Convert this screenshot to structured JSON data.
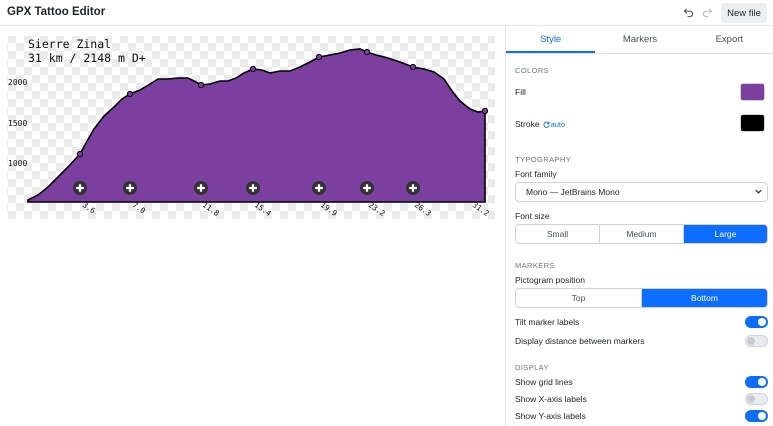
{
  "header": {
    "title": "GPX Tattoo Editor",
    "undo_icon": "undo-icon",
    "redo_icon": "redo-icon",
    "new_file_label": "New file"
  },
  "chart": {
    "title_line1": "Sierre Zinal",
    "title_line2": "31 km / 2148 m D+",
    "fill_color": "#7b3fa0",
    "stroke_color": "#000000",
    "y_ticks": [
      "2000",
      "1500",
      "1000"
    ],
    "x_ticks": [
      "3.6",
      "7.0",
      "11.8",
      "15.4",
      "19.9",
      "23.2",
      "26.3",
      "31.2"
    ],
    "marker_icon": "plus-icon"
  },
  "tabs": [
    "Style",
    "Markers",
    "Export"
  ],
  "colors": {
    "section_title": "COLORS",
    "fill_label": "Fill",
    "fill_value": "#7b3fa0",
    "stroke_label": "Stroke",
    "stroke_auto": "auto",
    "stroke_value": "#000000"
  },
  "typography": {
    "section_title": "TYPOGRAPHY",
    "font_family_label": "Font family",
    "font_family_value": "Mono — JetBrains Mono",
    "font_size_label": "Font size",
    "font_size_options": [
      "Small",
      "Medium",
      "Large"
    ],
    "font_size_selected": "Large"
  },
  "markers": {
    "section_title": "MARKERS",
    "pictogram_label": "Pictogram position",
    "pictogram_options": [
      "Top",
      "Bottom"
    ],
    "pictogram_selected": "Bottom",
    "tilt_label": "Tilt marker labels",
    "tilt_on": true,
    "distance_label": "Display distance between markers",
    "distance_on": false
  },
  "display": {
    "section_title": "DISPLAY",
    "grid_label": "Show grid lines",
    "grid_on": true,
    "xaxis_label": "Show X-axis labels",
    "xaxis_on": false,
    "yaxis_label": "Show Y-axis labels",
    "yaxis_on": true
  }
}
